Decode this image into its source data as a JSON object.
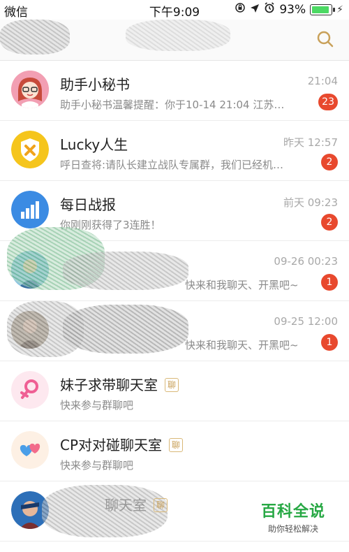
{
  "status_bar": {
    "carrier": "微信",
    "time": "下午9:09",
    "battery_percent": "93%",
    "battery_level": 0.93
  },
  "header": {
    "search_icon": "search-icon"
  },
  "chats": [
    {
      "title": "助手小秘书",
      "time": "21:04",
      "preview": "助手小秘书温馨提醒：你于10-14 21:04 江苏…",
      "badge": "23",
      "avatar": "assistant-girl-avatar"
    },
    {
      "title": "Lucky人生",
      "time": "昨天 12:57",
      "preview": "呼日查将:请队长建立战队专属群，我们已经机…",
      "badge": "2",
      "avatar": "lucky-shield-avatar"
    },
    {
      "title": "每日战报",
      "time": "前天 09:23",
      "preview": "你刚刚获得了3连胜！",
      "badge": "2",
      "avatar": "bar-chart-avatar"
    },
    {
      "title": "",
      "time": "09-26 00:23",
      "preview": "快来和我聊天、开黑吧~",
      "badge": "1",
      "avatar": "user-avatar"
    },
    {
      "title": "",
      "time": "09-25 12:00",
      "preview": "快来和我聊天、开黑吧~",
      "badge": "1",
      "avatar": "user-avatar"
    },
    {
      "title": "妹子求带聊天室",
      "tag": "聊",
      "time": "",
      "preview": "快来参与群聊吧",
      "badge": "",
      "avatar": "female-symbol-avatar"
    },
    {
      "title": "CP对对碰聊天室",
      "tag": "聊",
      "time": "",
      "preview": "快来参与群聊吧",
      "badge": "",
      "avatar": "hearts-avatar"
    },
    {
      "title": "聊天室",
      "tag": "聊",
      "time": "",
      "preview": "",
      "badge": "",
      "avatar": "game-hero-avatar"
    }
  ],
  "watermark": {
    "title": "百科全说",
    "subtitle": "助你轻松解决"
  }
}
